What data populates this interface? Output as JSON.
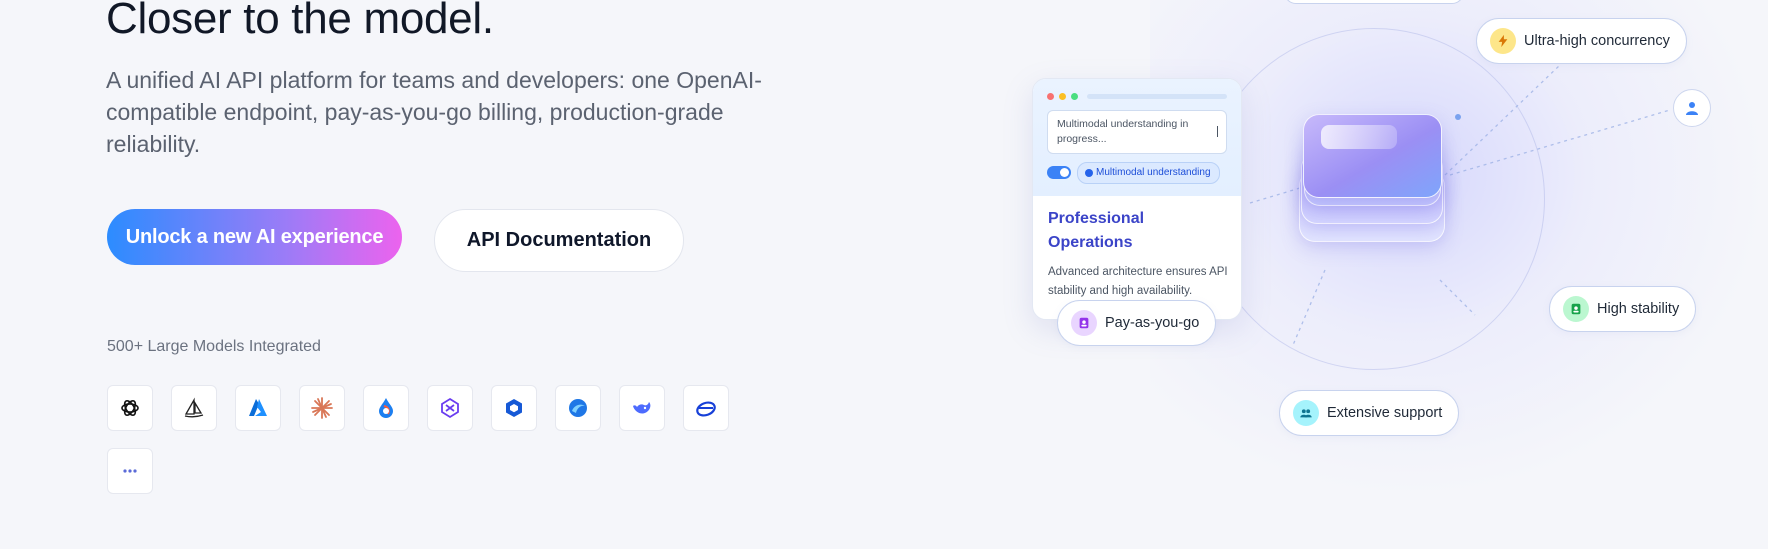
{
  "hero": {
    "title": "Closer to the model.",
    "subtitle": "A unified AI API platform for teams and developers: one OpenAI-compatible endpoint, pay-as-you-go billing, production-grade reliability.",
    "primary_button": "Unlock a new AI experience",
    "secondary_button": "API Documentation"
  },
  "models": {
    "label": "500+ Large Models Integrated",
    "icons": [
      "openai-logo-icon",
      "midjourney-logo-icon",
      "azure-logo-icon",
      "claude-logo-icon",
      "droplet-logo-icon",
      "perplexity-logo-icon",
      "hexagon-logo-icon",
      "swirl-logo-icon",
      "deepseek-logo-icon",
      "ring-logo-icon",
      "more-icon"
    ]
  },
  "card": {
    "input_text": "Multimodal understanding in progress...",
    "chip": "Multimodal understanding",
    "title": "Professional Operations",
    "description": "Advanced architecture ensures API stability and high availability."
  },
  "features": {
    "ultra_high_concurrency": "Ultra-high concurrency",
    "high_stability": "High stability",
    "pay_as_you_go": "Pay-as-you-go",
    "extensive_support": "Extensive support"
  },
  "colors": {
    "primary_gradient_start": "#2c8cff",
    "primary_gradient_end": "#ec63ee",
    "card_title": "#3b44c8",
    "concurrency_icon_bg": "#fde68a",
    "stability_icon_bg": "#bbf7d0",
    "payg_icon_bg": "#e9d5ff",
    "support_icon_bg": "#a5f3fc"
  }
}
